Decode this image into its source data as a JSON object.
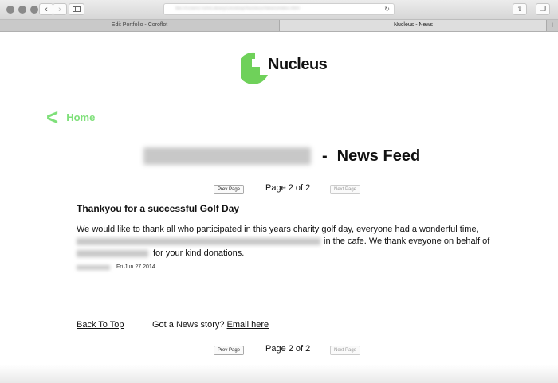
{
  "browser": {
    "url": "file:///Users/Tom/Library/Desktop/Nucleus/News/index.html",
    "tabs": [
      {
        "label": "Edit Portfolio - Coroflot"
      },
      {
        "label": "Nucleus - News"
      }
    ],
    "back_icon": "‹",
    "forward_icon": "›",
    "new_tab_icon": "+"
  },
  "site": {
    "logo_text": "Nucleus",
    "brand_color": "#6fd15a",
    "home_label": "Home",
    "home_icon": "<"
  },
  "feed": {
    "title_sep": "-",
    "title": "News Feed"
  },
  "pager": {
    "prev_label": "Prev Page",
    "next_label": "Next Page",
    "page_text": "Page 2 of 2"
  },
  "article": {
    "title": "Thankyou for a successful Golf Day",
    "body_line1": "We would like to thank all who participated in this years charity golf day, everyone had a wonderful time,",
    "body_line2_end": "in the cafe. We thank eveyone on behalf of",
    "body_line3_end": "for your kind donations.",
    "date": "Fri Jun 27 2014"
  },
  "footer": {
    "back_to_top": "Back To Top",
    "news_story_prompt": "Got a News story?",
    "email_link": "Email here"
  }
}
